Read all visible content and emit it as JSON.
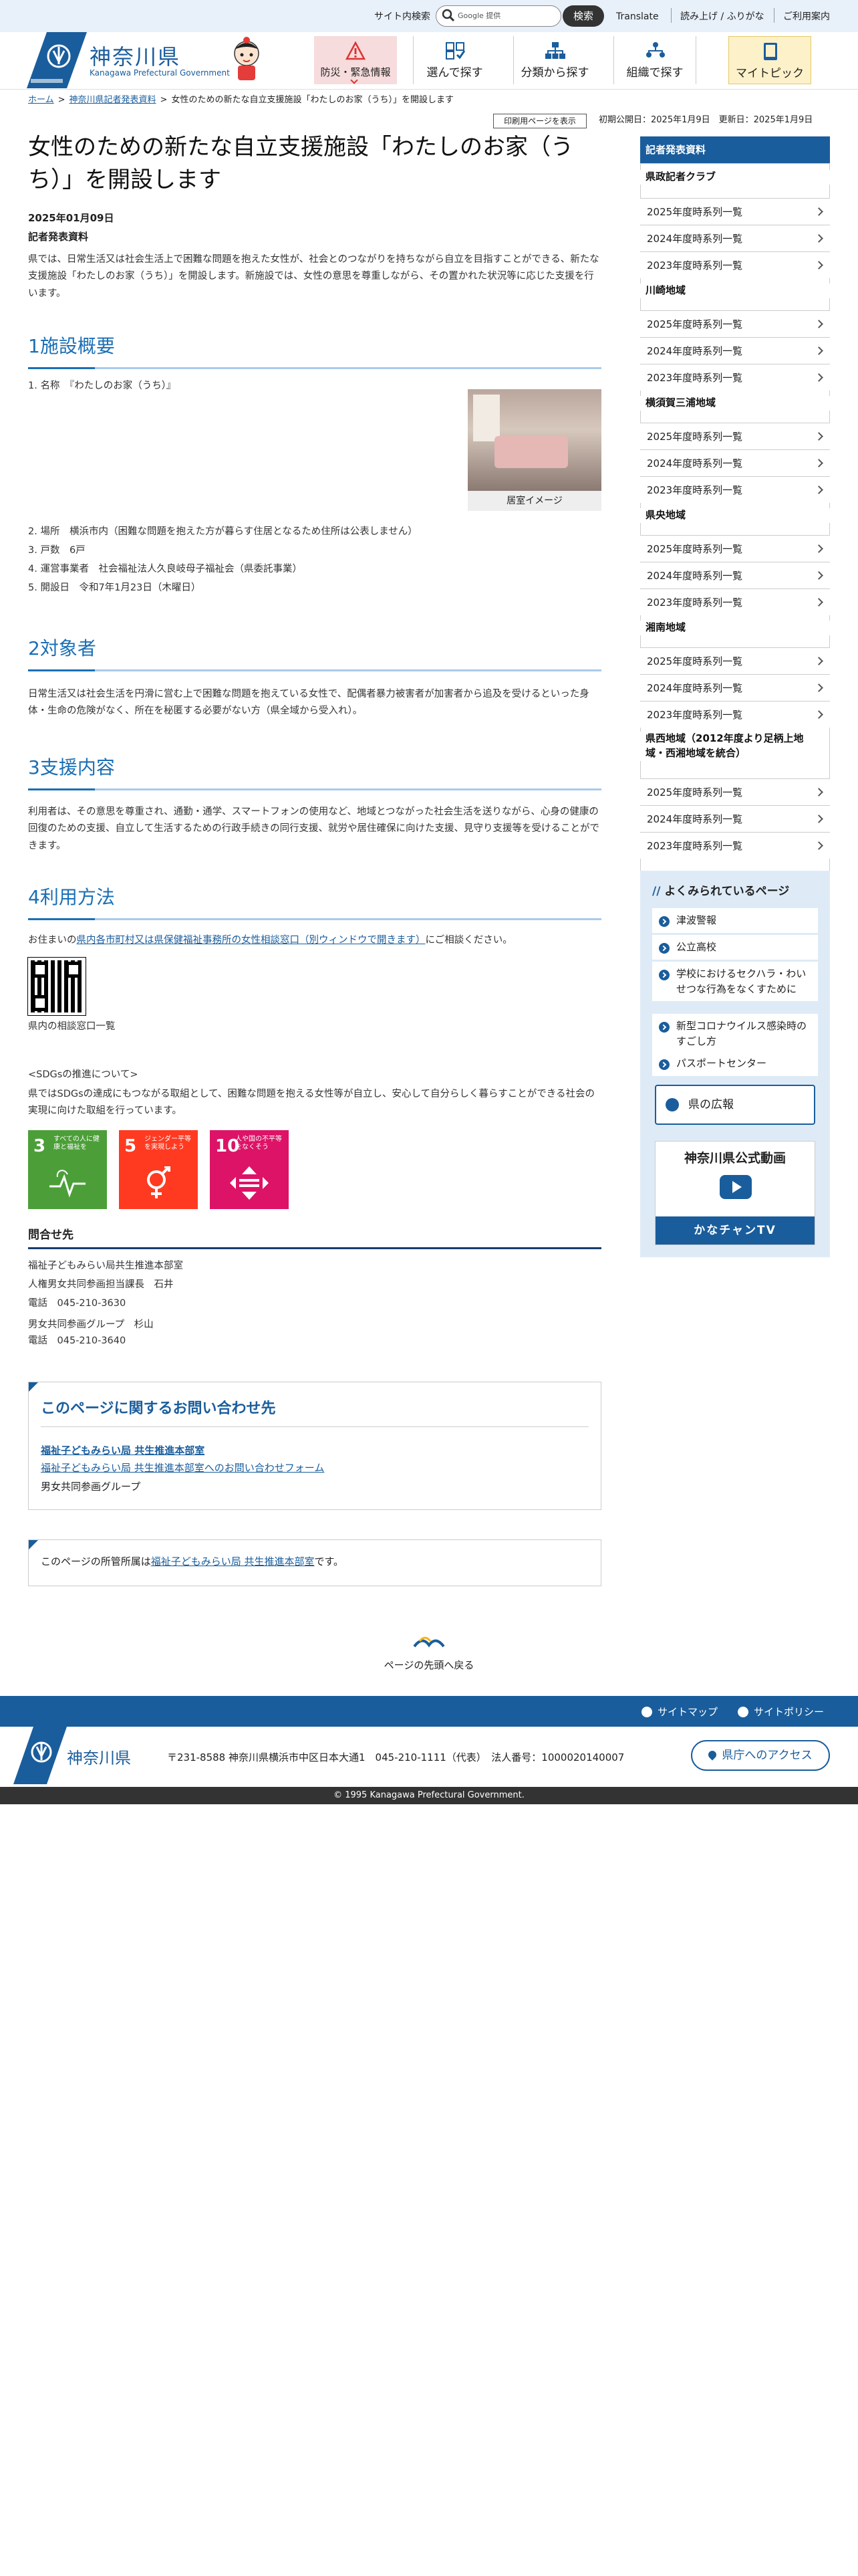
{
  "topbar": {
    "search_label": "サイト内検索",
    "search_placeholder": "Google 提供",
    "search_button": "検索",
    "links": [
      "Translate",
      "読み上げ / ふりがな",
      "ご利用案内"
    ]
  },
  "header": {
    "logo_title": "神奈川県",
    "logo_sub": "Kanagawa Prefectural Government",
    "nav": [
      "防災・緊急情報",
      "選んで探す",
      "分類から探す",
      "組織で探す",
      "マイトピック"
    ]
  },
  "breadcrumb": [
    "ホーム",
    "神奈川県記者発表資料",
    "女性のための新たな自立支援施設「わたしのお家（うち）」を開設します"
  ],
  "print_button": "印刷用ページを表示",
  "dates": "初期公開日：2025年1月9日　更新日：2025年1月9日",
  "article": {
    "title": "女性のための新たな自立支援施設「わたしのお家（うち）」を開設します",
    "date": "2025年01月09日",
    "doc_type": "記者発表資料",
    "intro": "県では、日常生活又は社会生活上で困難な問題を抱えた女性が、社会とのつながりを持ちながら自立を目指すことができる、新たな支援施設「わたしのお家（うち）」を開設します。新施設では、女性の意思を尊重しながら、その置かれた状況等に応じた支援を行います。",
    "sec1_title": "1施設概要",
    "sec1_items": [
      "1. 名称　『わたしのお家（うち）』",
      "2. 場所　横浜市内（困難な問題を抱えた方が暮らす住居となるため住所は公表しません）",
      "3. 戸数　6戸",
      "4. 運営事業者　社会福祉法人久良岐母子福祉会（県委託事業）",
      "5. 開設日　令和7年1月23日（木曜日）"
    ],
    "photo_caption": "居室イメージ",
    "sec2_title": "2対象者",
    "sec2_text": "日常生活又は社会生活を円滑に営む上で困難な問題を抱えている女性で、配偶者暴力被害者が加害者から追及を受けるといった身体・生命の危険がなく、所在を秘匿する必要がない方（県全域から受入れ）。",
    "sec3_title": "3支援内容",
    "sec3_text": "利用者は、その意思を尊重され、通勤・通学、スマートフォンの使用など、地域とつながった社会生活を送りながら、心身の健康の回復のための支援、自立して生活するための行政手続きの同行支援、就労や居住確保に向けた支援、見守り支援等を受けることができます。",
    "sec4_title": "4利用方法",
    "sec4_pre": "お住まいの",
    "sec4_link": "県内各市町村又は県保健福祉事務所の女性相談窓口（別ウィンドウで開きます）",
    "sec4_post": "にご相談ください。",
    "qr_caption": "県内の相談窓口一覧",
    "sdgs_heading": "<SDGsの推進について>",
    "sdgs_text": "県ではSDGsの達成にもつながる取組として、困難な問題を抱える女性等が自立し、安心して自分らしく暮らすことができる社会の実現に向けた取組を行っています。",
    "sdg_goals": [
      {
        "num": "3",
        "label": "すべての人に健康と福祉を",
        "color": "#4c9f38"
      },
      {
        "num": "5",
        "label": "ジェンダー平等を実現しよう",
        "color": "#ff3a21"
      },
      {
        "num": "10",
        "label": "人や国の不平等をなくそう",
        "color": "#dd1367"
      }
    ],
    "contact_title": "問合せ先",
    "contact_lines": [
      "福祉子どもみらい局共生推進本部室",
      "人権男女共同参画担当課長　石井",
      "電話　045-210-3630",
      "男女共同参画グループ　杉山",
      "電話　045-210-3640"
    ]
  },
  "ask": {
    "title": "このページに関するお問い合わせ先",
    "dept_link": "福祉子どもみらい局 共生推進本部室",
    "form_link": "福祉子どもみらい局 共生推進本部室へのお問い合わせフォーム",
    "group": "男女共同参画グループ"
  },
  "owner": {
    "pre": "このページの所管所属は",
    "link": "福祉子どもみらい局 共生推進本部室",
    "post": "です。"
  },
  "gotop": "ページの先頭へ戻る",
  "sidebar": {
    "head": "記者発表資料",
    "groups": [
      {
        "title": "県政記者クラブ",
        "items": [
          "2025年度時系列一覧",
          "2024年度時系列一覧",
          "2023年度時系列一覧"
        ]
      },
      {
        "title": "川崎地域",
        "items": [
          "2025年度時系列一覧",
          "2024年度時系列一覧",
          "2023年度時系列一覧"
        ]
      },
      {
        "title": "横須賀三浦地域",
        "items": [
          "2025年度時系列一覧",
          "2024年度時系列一覧",
          "2023年度時系列一覧"
        ]
      },
      {
        "title": "県央地域",
        "items": [
          "2025年度時系列一覧",
          "2024年度時系列一覧",
          "2023年度時系列一覧"
        ]
      },
      {
        "title": "湘南地域",
        "items": [
          "2025年度時系列一覧",
          "2024年度時系列一覧",
          "2023年度時系列一覧"
        ]
      },
      {
        "title": "県西地域（2012年度より足柄上地域・西湘地域を統合）",
        "items": [
          "2025年度時系列一覧",
          "2024年度時系列一覧",
          "2023年度時系列一覧"
        ]
      }
    ]
  },
  "faq": {
    "title": "よくみられているページ",
    "items": [
      "津波警報",
      "公立高校",
      "学校におけるセクハラ・わいせつな行為をなくすために",
      "新型コロナウイルス感染時のすごし方",
      "パスポートセンター"
    ],
    "pr_label": "県の広報",
    "video_title": "神奈川県公式動画",
    "video_strip": "かなチャンTV"
  },
  "footer": {
    "links": [
      "サイトマップ",
      "サイトポリシー"
    ],
    "title": "神奈川県",
    "address": "〒231-8588 神奈川県横浜市中区日本大通1　045-210-1111（代表）　法人番号：1000020140007",
    "access": "県庁へのアクセス",
    "copyright": "© 1995 Kanagawa Prefectural Government."
  }
}
